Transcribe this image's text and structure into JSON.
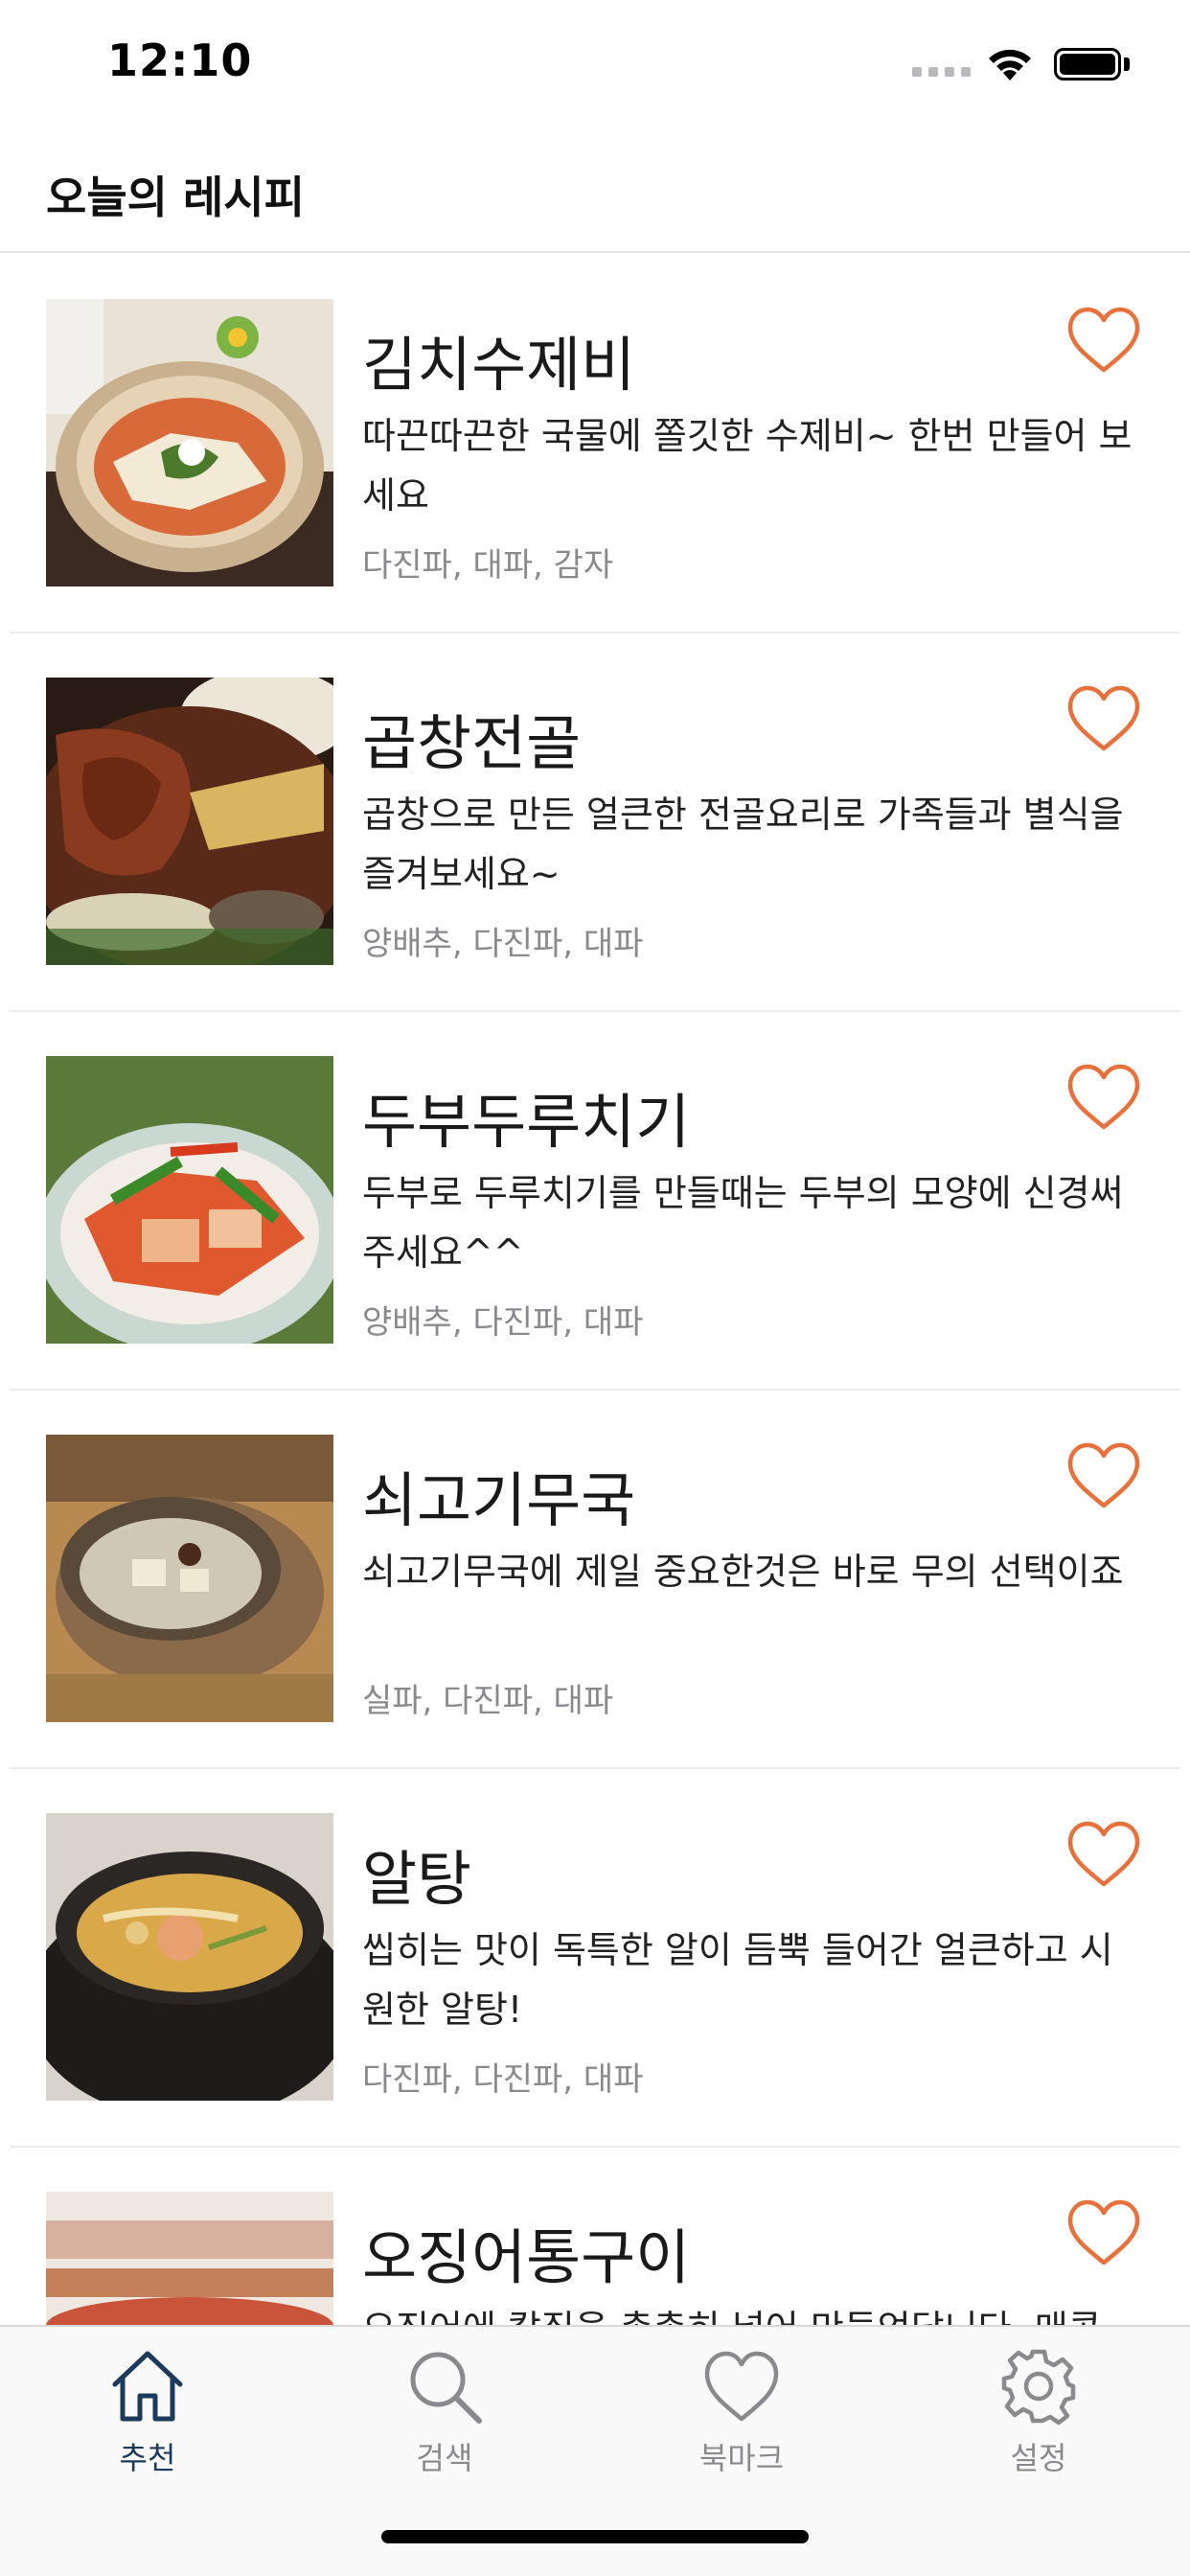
{
  "status_bar": {
    "time": "12:10"
  },
  "nav": {
    "title": "오늘의 레시피"
  },
  "colors": {
    "accent": "#E8703A",
    "tab_active": "#1B3A5C",
    "tab_inactive": "#8A8A8E"
  },
  "recipes": [
    {
      "title": "김치수제비",
      "description": "따끈따끈한 국물에 쫄깃한 수제비~ 한번 만들어 보세요",
      "ingredients": "다진파, 대파, 감자"
    },
    {
      "title": "곱창전골",
      "description": "곱창으로 만든 얼큰한 전골요리로 가족들과 별식을 즐겨보세요~",
      "ingredients": "양배추, 다진파, 대파"
    },
    {
      "title": "두부두루치기",
      "description": "두부로 두루치기를 만들때는 두부의 모양에 신경써 주세요^^",
      "ingredients": "양배추, 다진파, 대파"
    },
    {
      "title": "쇠고기무국",
      "description": "쇠고기무국에 제일 중요한것은 바로 무의 선택이죠",
      "ingredients": "실파, 다진파, 대파"
    },
    {
      "title": "알탕",
      "description": "씹히는 맛이 독특한 알이 듬뿍 들어간 얼큰하고 시원한 알탕!",
      "ingredients": "다진파, 다진파, 대파"
    },
    {
      "title": "오징어통구이",
      "description": "오징어에 칼집을 촘촘히 넣어 만들었답니다. 매콤",
      "ingredients": ""
    }
  ],
  "tabs": [
    {
      "label": "추천",
      "icon": "house-icon",
      "active": true
    },
    {
      "label": "검색",
      "icon": "magnifier-icon",
      "active": false
    },
    {
      "label": "북마크",
      "icon": "heart-icon",
      "active": false
    },
    {
      "label": "설정",
      "icon": "gear-icon",
      "active": false
    }
  ]
}
